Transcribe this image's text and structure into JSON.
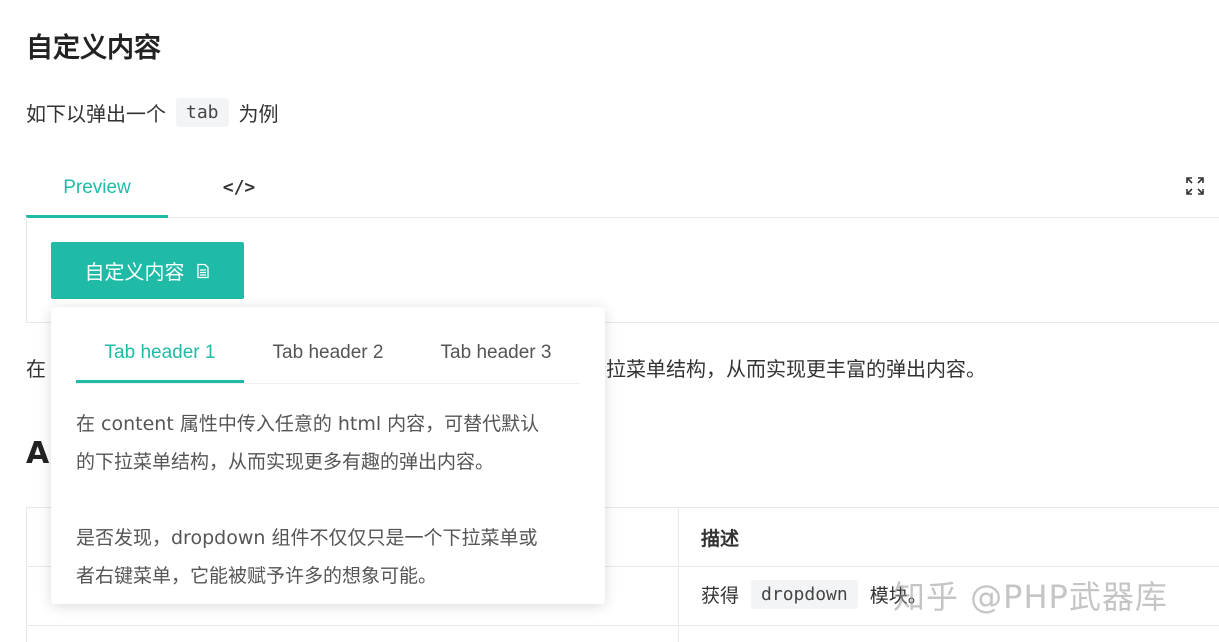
{
  "heading": "自定义内容",
  "intro": {
    "before": "如下以弹出一个",
    "code": "tab",
    "after": "为例"
  },
  "demo_tabs": {
    "preview": "Preview",
    "code": "</>"
  },
  "dropdown_button": {
    "label": "自定义内容",
    "icon": "document-icon"
  },
  "popup": {
    "tabs": [
      "Tab header 1",
      "Tab header 2",
      "Tab header 3"
    ],
    "active_tab": 0,
    "paragraph1_line1": "在 content 属性中传入任意的 html 内容，可替代默认",
    "paragraph1_line2": "的下拉菜单结构，从而实现更多有趣的弹出内容。",
    "paragraph2_line1": "是否发现，dropdown 组件不仅仅只是一个下拉菜单或",
    "paragraph2_line2": "者右键菜单，它能被赋予许多的想象可能。"
  },
  "after_text": {
    "left": "在",
    "right": "拉菜单结构，从而实现更丰富的弹出内容。"
  },
  "api_heading_visible": "A",
  "table": {
    "header_desc": "描述",
    "row1_desc_before": "获得",
    "row1_desc_code": "dropdown",
    "row1_desc_after": "模块。"
  },
  "watermark": "知乎 @PHP武器库",
  "colors": {
    "accent": "#1fbba6",
    "text": "#333333",
    "border": "#e8e8e8"
  }
}
